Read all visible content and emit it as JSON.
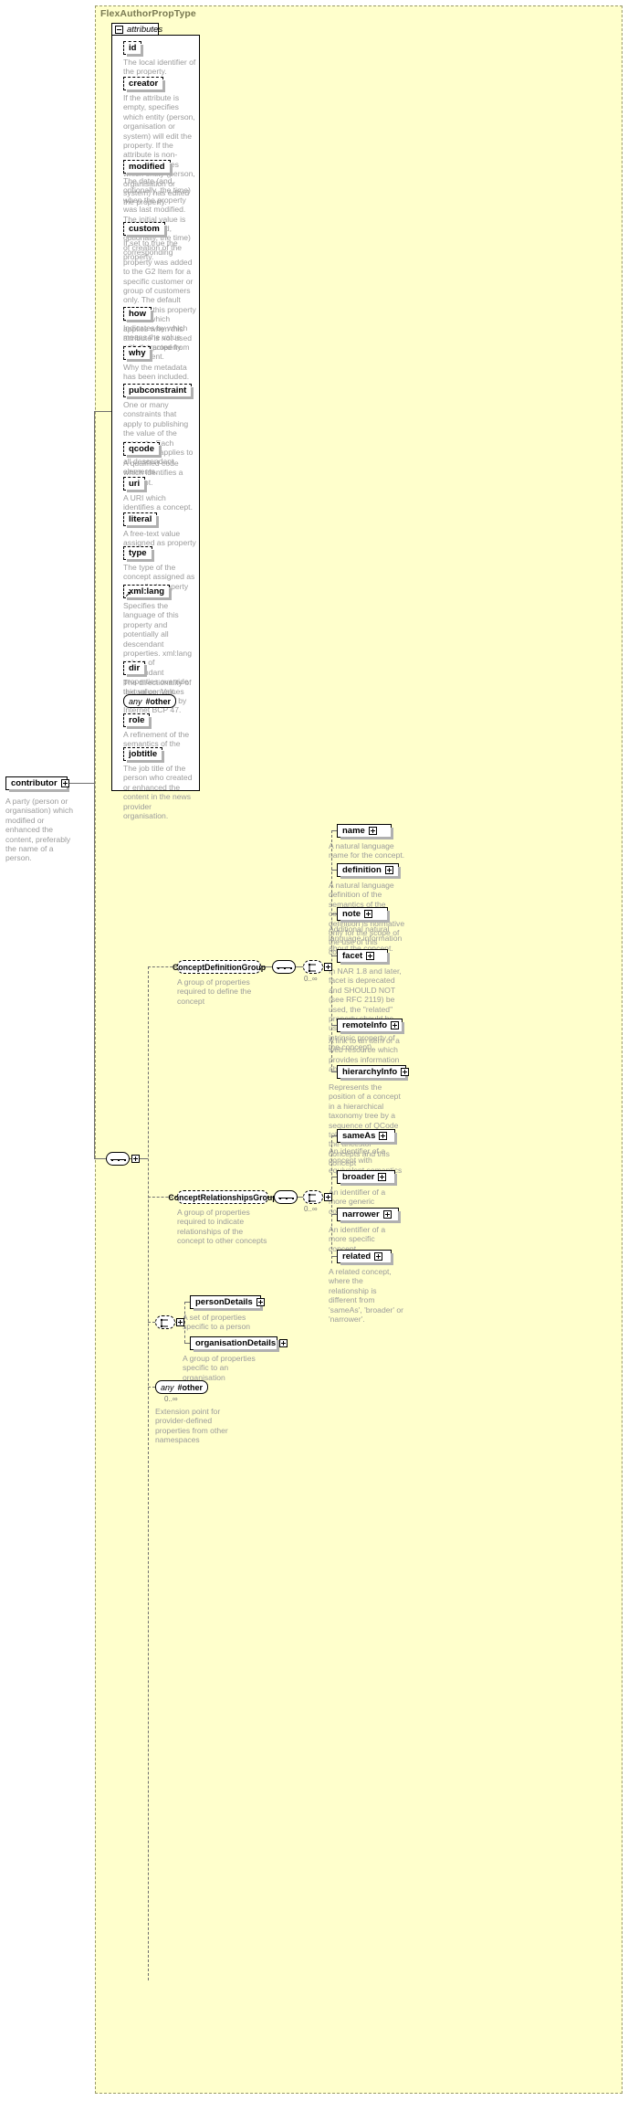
{
  "diagram": {
    "type_name": "FlexAuthorPropType",
    "attributes_label": "attributes",
    "root_element": {
      "name": "contributor",
      "description": "A party (person or organisation) which modified or enhanced the content, preferably the name of a person."
    },
    "attributes": [
      {
        "name": "id",
        "description": "The local identifier of the property."
      },
      {
        "name": "creator",
        "description": "If the attribute is empty, specifies which entity (person, organisation or system) will edit the property. If the attribute is non-empty, specifies which entity (person, organisation or system) has edited the property."
      },
      {
        "name": "modified",
        "description": "The date (and, optionally, the time) when the property was last modified. The initial value is the date (and, optionally, the time) of creation of the property."
      },
      {
        "name": "custom",
        "description": "If set to true the corresponding property was added to the G2 Item for a specific customer or group of customers only. The default value of this property is false which applies when this attribute is not used with the property."
      },
      {
        "name": "how",
        "description": "Indicates by which means the value was extracted from the content."
      },
      {
        "name": "why",
        "description": "Why the metadata has been included."
      },
      {
        "name": "pubconstraint",
        "description": "One or many constraints that apply to publishing the value of the property. Each constraint applies to all descendant elements."
      },
      {
        "name": "qcode",
        "description": "A qualified code which identifies a concept."
      },
      {
        "name": "uri",
        "description": "A URI which identifies a concept."
      },
      {
        "name": "literal",
        "description": "A free-text value assigned as property value."
      },
      {
        "name": "type",
        "description": "The type of the concept assigned as controlled property value."
      },
      {
        "name": "xml:lang",
        "description": "Specifies the language of this property and potentially all descendant properties. xml:lang values of descendant properties override this value. Values are determined by Internet BCP 47."
      },
      {
        "name": "dir",
        "description": "The directionality of textual content."
      },
      {
        "name": "any",
        "namespace": "#other",
        "description": ""
      },
      {
        "name": "role",
        "description": "A refinement of the semantics of the property."
      },
      {
        "name": "jobtitle",
        "description": "The job title of the person who created or enhanced the content in the news provider organisation."
      }
    ],
    "groups": [
      {
        "id": "concept-definition-group",
        "name": "ConceptDefinitionGroup",
        "description": "A group of properties required to define the concept",
        "occurs": "0..∞",
        "children": [
          {
            "name": "name",
            "description": "A natural language name for the concept."
          },
          {
            "name": "definition",
            "description": "A natural language definition of the semantics of the concept. This definition is normative only for the scope of the use of this concept."
          },
          {
            "name": "note",
            "description": "Additional natural language information about the concept."
          },
          {
            "name": "facet",
            "description": "In NAR 1.8 and later, facet is deprecated and SHOULD NOT (see RFC 2119) be used, the \"related\" property should be used instead (was an intrinsic property of the concept)."
          },
          {
            "name": "remoteInfo",
            "description": "A link to an item or a web resource which provides information about the concept."
          },
          {
            "name": "hierarchyInfo",
            "description": "Represents the position of a concept in a hierarchical taxonomy tree by a sequence of QCode tokens representing the ancestor concepts and this concept"
          }
        ]
      },
      {
        "id": "concept-relationships-group",
        "name": "ConceptRelationshipsGroup",
        "description": "A group of properties required to indicate relationships of the concept to other concepts",
        "occurs": "0..∞",
        "children": [
          {
            "name": "sameAs",
            "description": "An identifier of a concept with equivalent semantics"
          },
          {
            "name": "broader",
            "description": "An identifier of a more generic concept."
          },
          {
            "name": "narrower",
            "description": "An identifier of a more specific concept."
          },
          {
            "name": "related",
            "description": "A related concept, where the relationship is different from 'sameAs', 'broader' or 'narrower'."
          }
        ]
      }
    ],
    "detail_elements": [
      {
        "name": "personDetails",
        "description": "A set of properties specific to a person"
      },
      {
        "name": "organisationDetails",
        "description": "A group of properties specific to an organisation"
      }
    ],
    "any_other": {
      "label_any": "any",
      "label_ns": "#other",
      "occurs": "0..∞",
      "description": "Extension point for provider-defined properties from other namespaces"
    }
  }
}
